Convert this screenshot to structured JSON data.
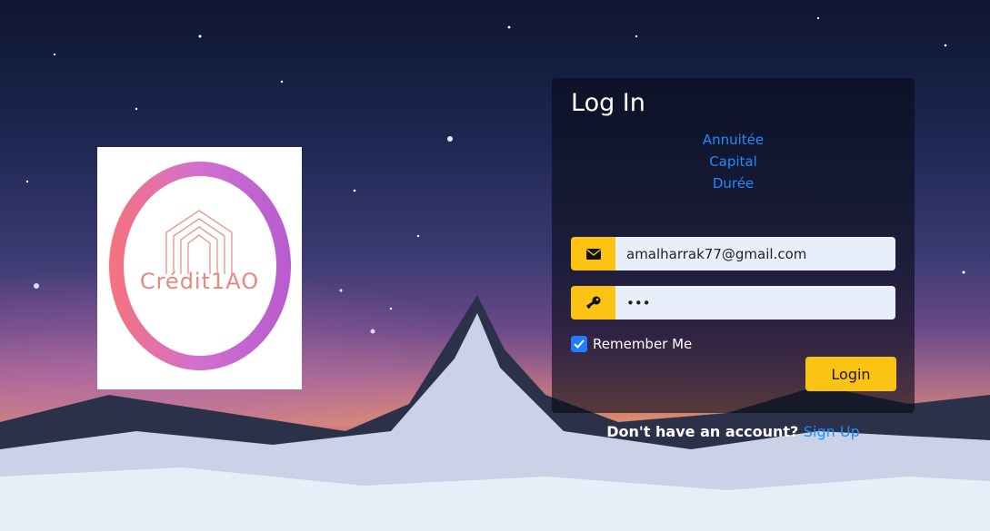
{
  "logo": {
    "text": "Crédit1AO"
  },
  "login_panel": {
    "title": "Log In",
    "links": [
      {
        "label": "Annuitée"
      },
      {
        "label": "Capital"
      },
      {
        "label": "Durée"
      }
    ],
    "email": {
      "value": "amalharrak77@gmail.com",
      "icon": "envelope-icon"
    },
    "password": {
      "value": "•••",
      "icon": "key-icon"
    },
    "remember_me": {
      "label": "Remember Me",
      "checked": true
    },
    "login_button": "Login"
  },
  "signup": {
    "prompt": "Don't have an account?",
    "link": "Sign Up"
  },
  "colors": {
    "accent": "#fbc414",
    "link": "#1e8cff"
  }
}
